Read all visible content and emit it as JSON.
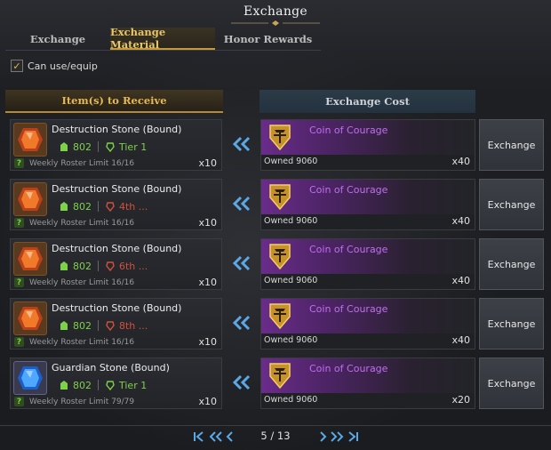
{
  "window": {
    "title": "Exchange"
  },
  "tabs": [
    {
      "label": "Exchange"
    },
    {
      "label": "Exchange Material"
    },
    {
      "label": "Honor Rewards"
    }
  ],
  "filter": {
    "label": "Can use/equip",
    "checked": true
  },
  "columns": {
    "receive": "Item(s) to Receive",
    "cost": "Exchange Cost"
  },
  "rows": [
    {
      "item_name": "Destruction Stone (Bound)",
      "item_color": "orange",
      "level": "802",
      "tier": "Tier 1",
      "tier_color": "green",
      "limit": "Weekly Roster Limit 16/16",
      "qty": "x10",
      "cost_name": "Coin of Courage",
      "owned": "Owned 9060",
      "cost_qty": "x40",
      "button": "Exchange"
    },
    {
      "item_name": "Destruction Stone (Bound)",
      "item_color": "orange",
      "level": "802",
      "tier": "4th ...",
      "tier_color": "red",
      "limit": "Weekly Roster Limit 16/16",
      "qty": "x10",
      "cost_name": "Coin of Courage",
      "owned": "Owned 9060",
      "cost_qty": "x40",
      "button": "Exchange"
    },
    {
      "item_name": "Destruction Stone (Bound)",
      "item_color": "orange",
      "level": "802",
      "tier": "6th ...",
      "tier_color": "red",
      "limit": "Weekly Roster Limit 16/16",
      "qty": "x10",
      "cost_name": "Coin of Courage",
      "owned": "Owned 9060",
      "cost_qty": "x40",
      "button": "Exchange"
    },
    {
      "item_name": "Destruction Stone (Bound)",
      "item_color": "orange",
      "level": "802",
      "tier": "8th ...",
      "tier_color": "red",
      "limit": "Weekly Roster Limit 16/16",
      "qty": "x10",
      "cost_name": "Coin of Courage",
      "owned": "Owned 9060",
      "cost_qty": "x40",
      "button": "Exchange"
    },
    {
      "item_name": "Guardian Stone (Bound)",
      "item_color": "blue",
      "level": "802",
      "tier": "Tier 1",
      "tier_color": "green",
      "limit": "Weekly Roster Limit 79/79",
      "qty": "x10",
      "cost_name": "Coin of Courage",
      "owned": "Owned 9060",
      "cost_qty": "x20",
      "button": "Exchange"
    }
  ],
  "pagination": {
    "text": "5 / 13"
  },
  "colors": {
    "accent_gold": "#e7b851",
    "coin_purple": "#c16ef0",
    "level_green": "#7ed14a",
    "tier_red": "#d2503c",
    "arrow_blue": "#5aa9e6"
  }
}
